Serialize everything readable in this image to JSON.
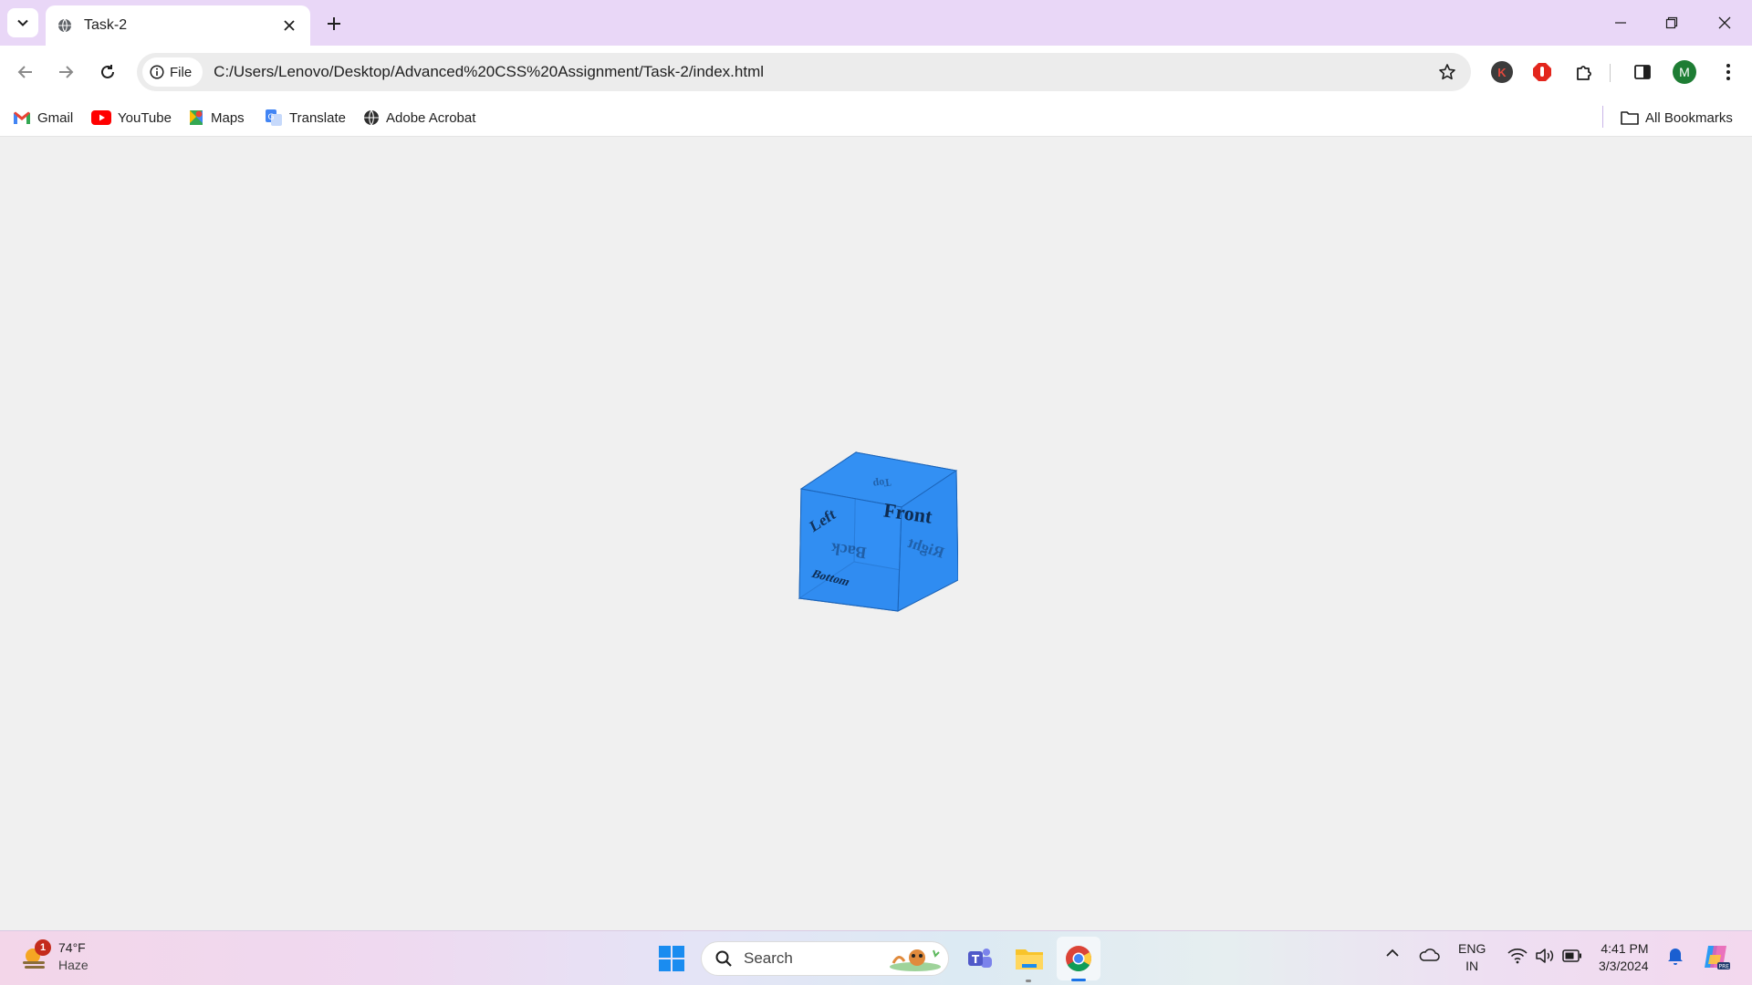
{
  "browser": {
    "tab_title": "Task-2",
    "site_chip": "File",
    "url": "C:/Users/Lenovo/Desktop/Advanced%20CSS%20Assignment/Task-2/index.html",
    "profile_initial": "M",
    "extension_initial": "K"
  },
  "bookmarks": {
    "items": [
      {
        "label": "Gmail",
        "icon": "gmail-icon"
      },
      {
        "label": "YouTube",
        "icon": "youtube-icon"
      },
      {
        "label": "Maps",
        "icon": "maps-icon"
      },
      {
        "label": "Translate",
        "icon": "translate-icon"
      },
      {
        "label": "Adobe Acrobat",
        "icon": "globe-icon"
      }
    ],
    "all_bookmarks": "All Bookmarks"
  },
  "cube": {
    "color": "#2f8cf1",
    "faces": {
      "front": "Front",
      "back": "Back",
      "left": "Left",
      "right": "Right",
      "top": "Top",
      "bottom": "Bottom"
    }
  },
  "taskbar": {
    "weather_temp": "74°F",
    "weather_desc": "Haze",
    "weather_badge": "1",
    "search_label": "Search",
    "lang_line1": "ENG",
    "lang_line2": "IN",
    "time": "4:41 PM",
    "date": "3/3/2024"
  },
  "colors": {
    "tabstrip": "#e9d7f7",
    "page_bg": "#f0f0f0",
    "accent": "#1a73e8"
  }
}
